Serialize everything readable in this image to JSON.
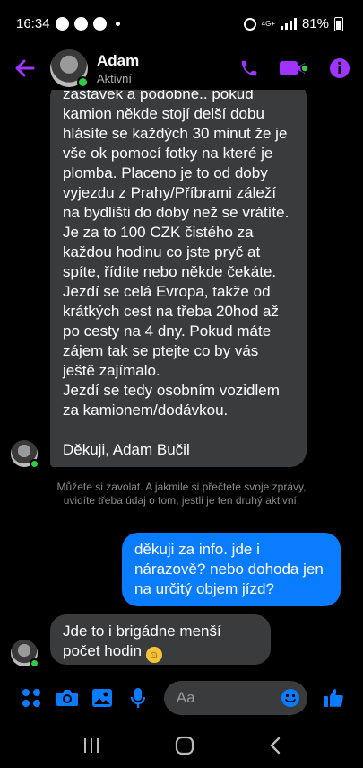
{
  "status_bar": {
    "time": "16:34",
    "network": "4G+",
    "battery": "81%"
  },
  "colors": {
    "accent": "#a033ff",
    "messenger_blue": "#0a7cff",
    "online": "#31cc46"
  },
  "header": {
    "name": "Adam",
    "presence": "Aktivní",
    "icons": [
      "back-arrow-icon",
      "phone-icon",
      "video-call-icon",
      "info-icon"
    ]
  },
  "messages": {
    "long_incoming": "Náplní práce je doprovod, doložení na náklad, že je stále zaplombován a dávání infa o průběhu cesty.. to jest hlášení zastávek a podobně.. pokud kamion někde stojí delší dobu hlásíte se každých 30 minut že je vše ok pomocí fotky na které je plomba. Placeno je to od doby vyjezdu z Prahy/Příbrami záleží na bydlišti do doby než se vrátíte. Je za to 100 CZK čistého za každou hodinu co jste pryč at spíte, řídíte nebo někde čekáte. Jezdí se celá Evropa, takže od krátkých cest na třeba 20hod až po cesty na 4 dny. Pokud máte zájem tak se ptejte co by vás ještě zajímalo.\nJezdí se tedy osobním vozidlem za kamionem/dodávkou.\n\nDěkuji, Adam Bučil",
    "notice": "Můžete si zavolat. A jakmile si přečtete svoje zprávy, uvidíte třeba údaj o tom, jestli je ten druhý aktivní.",
    "outgoing": "děkuji za info. jde i nárazově? nebo dohoda jen na určitý objem jízd?",
    "short_incoming": "Jde to i brigádne menší počet hodin"
  },
  "composer": {
    "placeholder": "Aa"
  }
}
